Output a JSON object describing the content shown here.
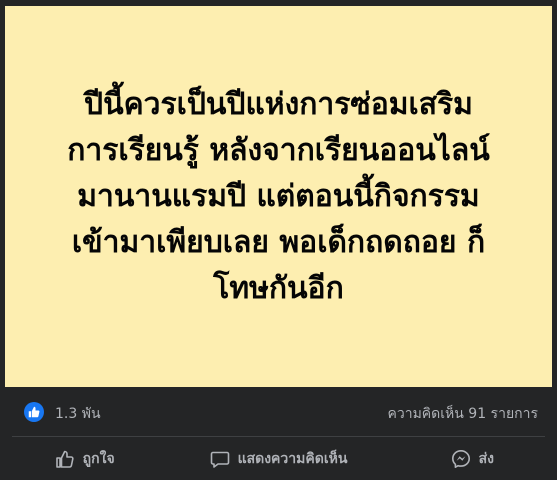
{
  "post": {
    "text": "ปีนี้ควรเป็นปีแห่งการซ่อมเสริม\nการเรียนรู้ หลังจากเรียนออนไลน์\nมานานแรมปี แต่ตอนนี้กิจกรรม\nเข้ามาเพียบเลย พอเด็กถดถอย ก็\nโทษกันอีก",
    "background_color": "#fdeeb0"
  },
  "stats": {
    "reaction_count": "1.3 พัน",
    "comment_count": "ความคิดเห็น 91 รายการ",
    "reaction_icon": "like-icon"
  },
  "actions": {
    "like_label": "ถูกใจ",
    "comment_label": "แสดงความคิดเห็น",
    "share_label": "ส่ง"
  }
}
